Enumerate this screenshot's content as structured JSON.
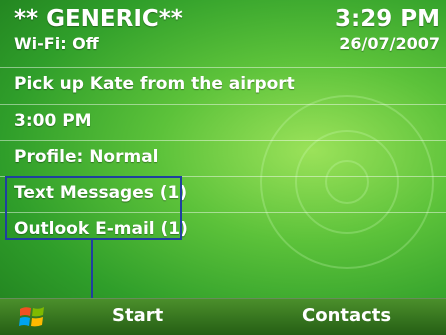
{
  "status": {
    "operator": "** GENERIC**",
    "wifi": "Wi-Fi: Off",
    "time": "3:29 PM",
    "date": "26/07/2007"
  },
  "items": [
    {
      "label": "Pick up Kate from the airport"
    },
    {
      "label": "3:00 PM"
    },
    {
      "label": "Profile: Normal"
    },
    {
      "label": "Text Messages (1)"
    },
    {
      "label": "Outlook E-mail (1)"
    }
  ],
  "softkeys": {
    "left": "Start",
    "right": "Contacts"
  },
  "colors": {
    "accent_blue": "#1f3fa0",
    "bar_green": "#2f7a1c"
  }
}
